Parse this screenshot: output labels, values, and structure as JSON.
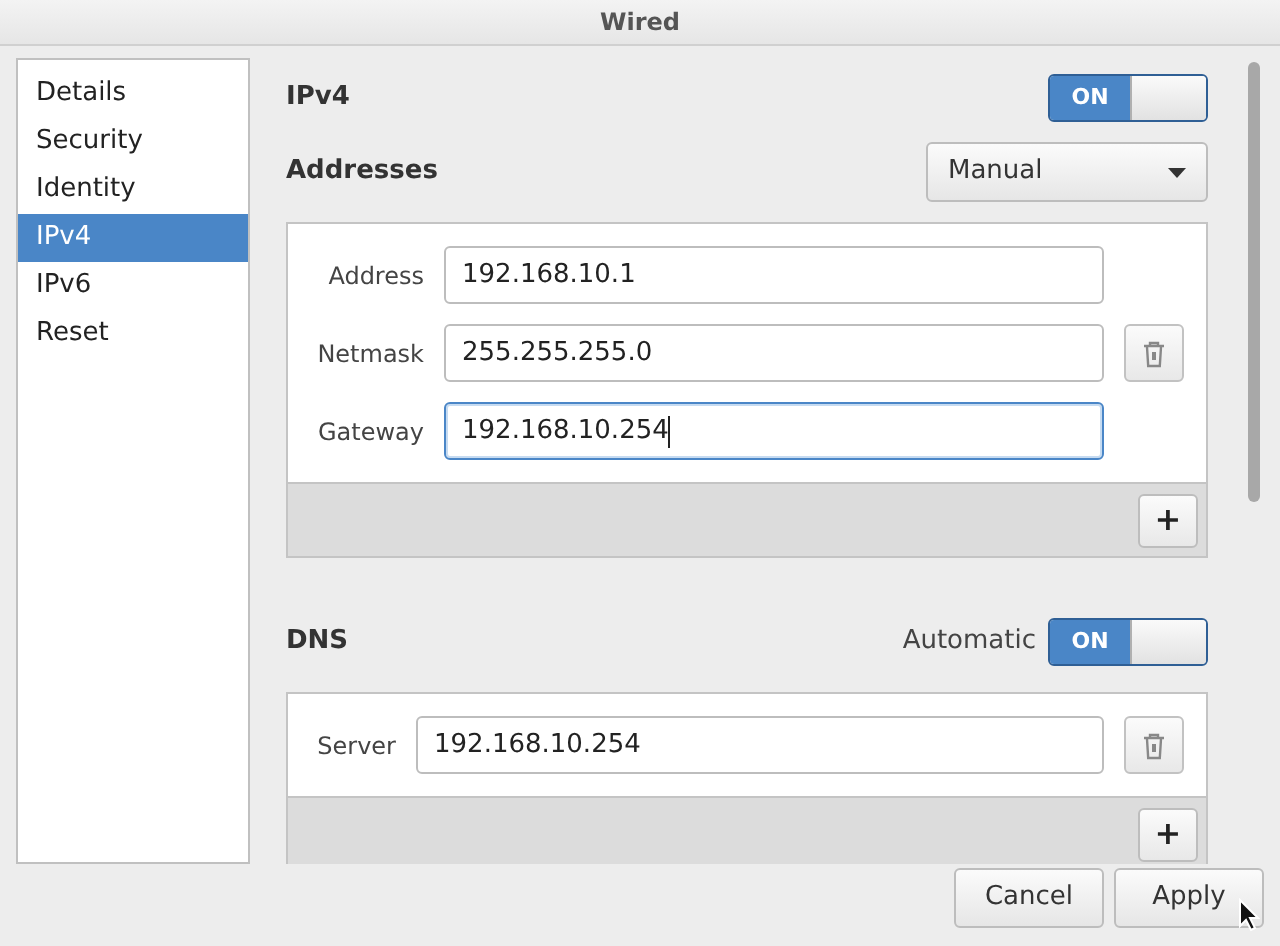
{
  "window": {
    "title": "Wired"
  },
  "sidebar": {
    "items": [
      {
        "label": "Details",
        "selected": false
      },
      {
        "label": "Security",
        "selected": false
      },
      {
        "label": "Identity",
        "selected": false
      },
      {
        "label": "IPv4",
        "selected": true
      },
      {
        "label": "IPv6",
        "selected": false
      },
      {
        "label": "Reset",
        "selected": false
      }
    ]
  },
  "ipv4": {
    "title": "IPv4",
    "switch": {
      "label": "ON",
      "on": true
    }
  },
  "addresses": {
    "title": "Addresses",
    "method": "Manual",
    "fields": [
      {
        "label": "Address",
        "value": "192.168.10.1",
        "focused": false
      },
      {
        "label": "Netmask",
        "value": "255.255.255.0",
        "focused": false
      },
      {
        "label": "Gateway",
        "value": "192.168.10.254",
        "focused": true
      }
    ],
    "add_button": "+"
  },
  "dns": {
    "title": "DNS",
    "automatic_label": "Automatic",
    "switch": {
      "label": "ON",
      "on": true
    },
    "fields": [
      {
        "label": "Server",
        "value": "192.168.10.254",
        "focused": false
      }
    ],
    "add_button": "+"
  },
  "buttons": [
    "Cancel",
    "Apply"
  ]
}
